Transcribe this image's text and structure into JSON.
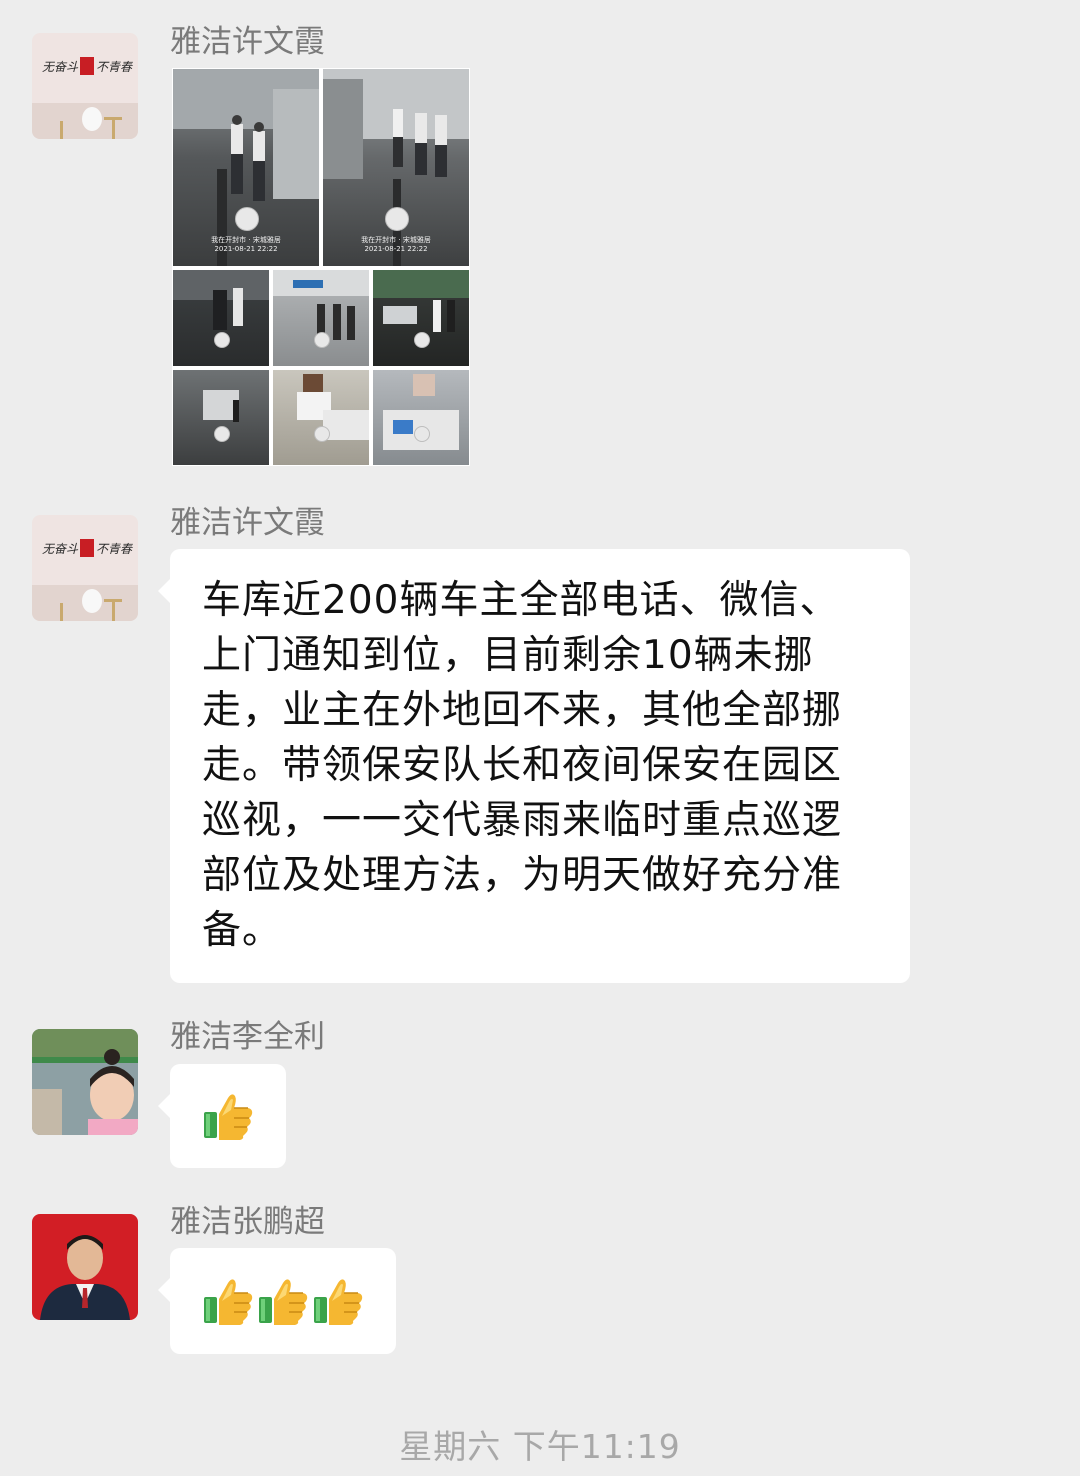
{
  "messages": [
    {
      "sender": "雅洁许文霞",
      "type": "images",
      "image_captions": [
        "我在开封市 · 宋城雅居",
        "我在开封市 · 宋城雅居"
      ],
      "image_dates": [
        "2021-08-21 22:22",
        "2021-08-21 22:22"
      ]
    },
    {
      "sender": "雅洁许文霞",
      "type": "text",
      "text": "车库近200辆车主全部电话、微信、上门通知到位，目前剩余10辆未挪走，业主在外地回不来，其他全部挪走。带领保安队长和夜间保安在园区巡视，一一交代暴雨来临时重点巡逻部位及处理方法，为明天做好充分准备。"
    },
    {
      "sender": "雅洁李全利",
      "type": "emoji",
      "emoji_name": "thumbs-up-icon",
      "count": 1
    },
    {
      "sender": "雅洁张鹏超",
      "type": "emoji",
      "emoji_name": "thumbs-up-icon",
      "count": 3
    }
  ],
  "timestamp": "星期六 下午11:19",
  "colors": {
    "background": "#ededed",
    "bubble": "#ffffff",
    "sender_name": "#7a7a7a",
    "timestamp": "#a8a8a8"
  }
}
